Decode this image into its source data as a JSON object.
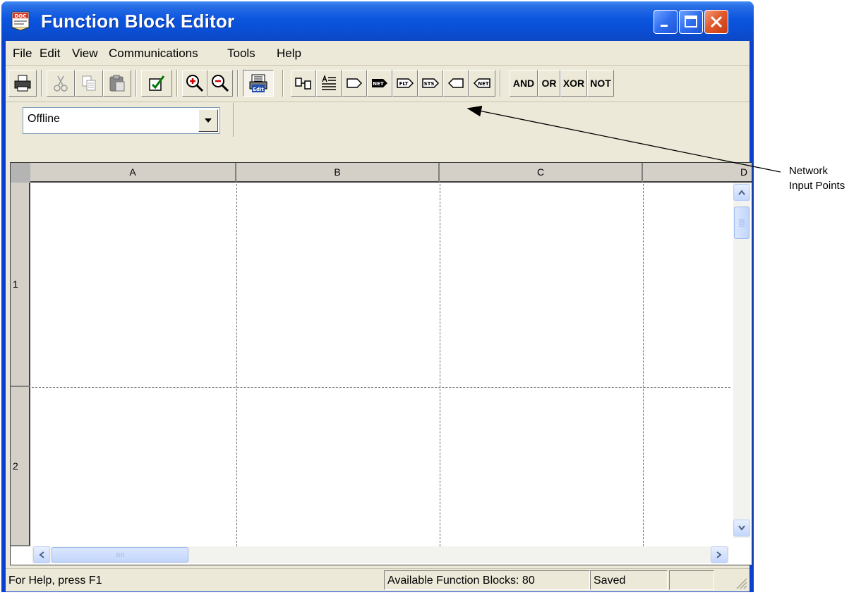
{
  "window": {
    "title": "Function Block Editor",
    "icon": "doc-app-icon",
    "app_icon_text": "DOC",
    "controls": [
      "minimize-icon",
      "maximize-icon",
      "close-icon"
    ]
  },
  "menu": [
    "File",
    "Edit",
    "View",
    "Communications",
    "Tools",
    "Help"
  ],
  "toolbar": {
    "icon_buttons": [
      "print-icon",
      "cut-icon",
      "copy-icon",
      "paste-icon",
      "verify-icon",
      "zoom-in-icon",
      "zoom-out-icon",
      "edit-mode-icon",
      "function-block-icon",
      "text-block-icon",
      "input-icon",
      "network-input-icon",
      "float-input-icon",
      "status-input-icon",
      "output-icon",
      "network-output-icon"
    ],
    "edit_icon_text": "Edit",
    "network_input_text": "NET",
    "float_input_text": "FLT",
    "status_input_text": "STS",
    "network_output_text": "NET",
    "logic_buttons": [
      "AND",
      "OR",
      "XOR",
      "NOT"
    ]
  },
  "mode": {
    "selected": "Offline"
  },
  "grid": {
    "columns": [
      "A",
      "B",
      "C",
      "D"
    ],
    "rows": [
      "1",
      "2"
    ]
  },
  "statusbar": {
    "help": "For Help, press F1",
    "available": "Available Function Blocks: 80",
    "state": "Saved"
  },
  "annotation": {
    "line1": "Network",
    "line2": "Input Points"
  }
}
